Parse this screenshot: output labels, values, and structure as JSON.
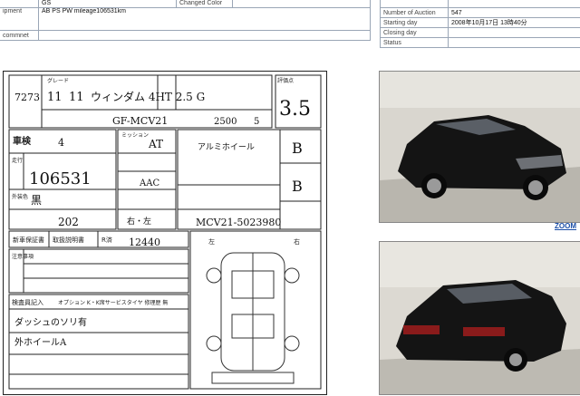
{
  "top_left": {
    "row1": {
      "label": "",
      "value": "GS",
      "label2": "Changed Color",
      "value2": ""
    },
    "row2": {
      "label": "ipment",
      "value": "AB PS PW mileage106531km"
    },
    "row3": {
      "label": "commnet",
      "value": ""
    }
  },
  "top_right": {
    "rows": [
      {
        "label": "",
        "value": ""
      },
      {
        "label": "Number of Auction",
        "value": "547"
      },
      {
        "label": "Starting day",
        "value": "2008年10月17日 13時40分"
      },
      {
        "label": "Closing day",
        "value": ""
      },
      {
        "label": "Status",
        "value": ""
      }
    ]
  },
  "sheet": {
    "lot_number": "7273",
    "year": "11",
    "month": "11",
    "model_name": "ウィンダム 4HT 2.5 G",
    "grade_label": "グレード",
    "chassis_code": "GF-MCV21",
    "displacement": "2500",
    "seats": "5",
    "score": "3.5",
    "score_label": "評価点",
    "shaken_label": "車検",
    "shaken_month": "4",
    "mileage_label": "走行",
    "mileage": "106531",
    "color_label": "外装色",
    "color": "黒",
    "color_code": "202",
    "trans_label": "ミッション",
    "trans": "AT",
    "ac": "AAC",
    "steering": "右・左",
    "wheel_note": "アルミホイール",
    "interior_grade": "B",
    "exterior_grade": "B",
    "frame_number": "MCV21-5023980",
    "record_label": "新車保証書",
    "manual_label": "取扱説明書",
    "recycle_label": "R済",
    "recycle_amount": "12440",
    "notes_label": "注意事項",
    "inspector_label": "検査員記入",
    "inspector_text": "オプション K・K席サービスタイヤ 修理歴 無",
    "remark1": "ダッシュのソリ有",
    "remark2": "外ホイールA",
    "diagram_left": "左",
    "diagram_right": "右"
  },
  "zoom_label": "ZOOM"
}
